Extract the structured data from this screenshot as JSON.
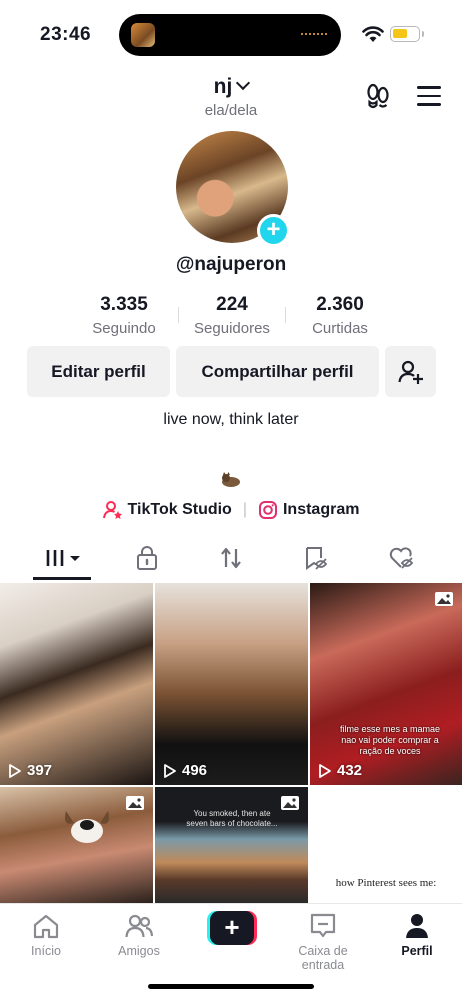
{
  "status_bar": {
    "time": "23:46",
    "battery_level": 0.6,
    "battery_color": "#f5c518",
    "icons": [
      "wifi-icon",
      "battery-icon"
    ]
  },
  "header": {
    "name": "nj",
    "pronouns": "ela/dela",
    "icons": [
      "footsteps-icon",
      "menu-icon"
    ]
  },
  "profile": {
    "username": "@najuperon",
    "bio": "live now, think later",
    "stats": [
      {
        "value": "3.335",
        "label": "Seguindo"
      },
      {
        "value": "224",
        "label": "Seguidores"
      },
      {
        "value": "2.360",
        "label": "Curtidas"
      }
    ]
  },
  "buttons": {
    "edit": "Editar perfil",
    "share": "Compartilhar perfil"
  },
  "links": {
    "studio": "TikTok Studio",
    "instagram": "Instagram"
  },
  "tabs": [
    "videos-grid-icon",
    "lock-icon",
    "repost-icon",
    "favorites-icon",
    "liked-icon"
  ],
  "videos": [
    {
      "views": "397",
      "type": "video"
    },
    {
      "views": "496",
      "type": "video"
    },
    {
      "views": "432",
      "type": "photo",
      "caption": "filme esse mes a mamae nao vai poder comprar a ração de voces"
    },
    {
      "type": "photo"
    },
    {
      "type": "photo",
      "caption": "You smoked, then ate seven bars of chocolate..."
    },
    {
      "type": "text",
      "caption": "how Pinterest sees me:"
    }
  ],
  "bottom_nav": [
    {
      "label": "Início",
      "icon": "home-icon"
    },
    {
      "label": "Amigos",
      "icon": "friends-icon"
    },
    {
      "label": "",
      "icon": "create-icon"
    },
    {
      "label": "Caixa de entrada",
      "icon": "inbox-icon"
    },
    {
      "label": "Perfil",
      "icon": "profile-icon",
      "active": true
    }
  ],
  "colors": {
    "accent_cyan": "#20d5ec",
    "tiktok_red": "#fe2c55",
    "tiktok_cyan": "#25f4ee"
  }
}
